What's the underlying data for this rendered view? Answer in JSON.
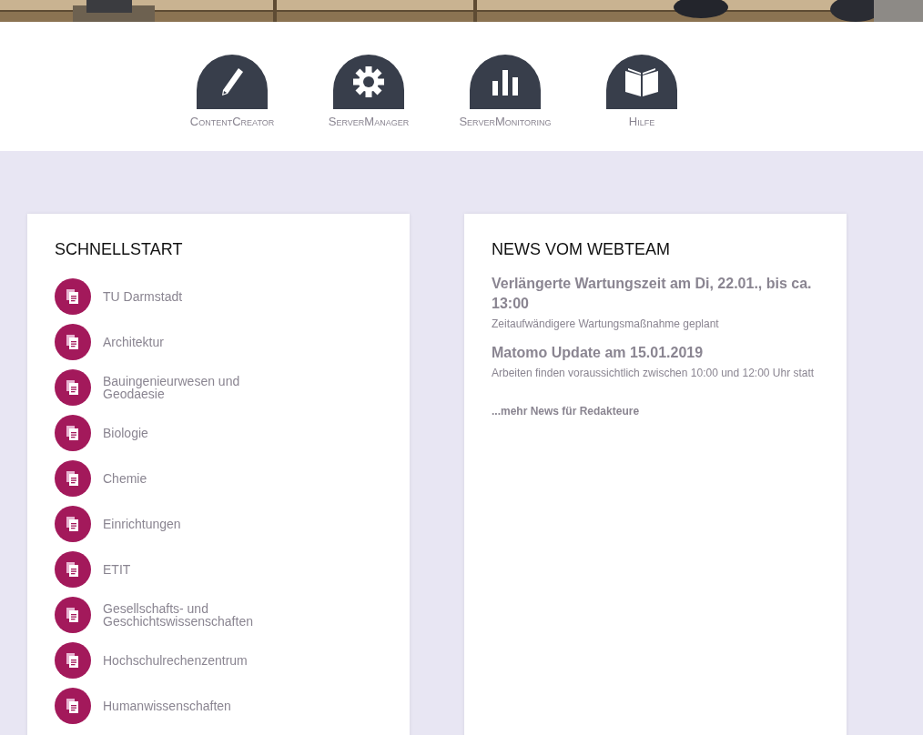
{
  "tools": [
    {
      "label": "ContentCreator"
    },
    {
      "label": "ServerManager"
    },
    {
      "label": "ServerMonitoring"
    },
    {
      "label": "Hilfe"
    }
  ],
  "quickstart": {
    "title": "SCHNELLSTART",
    "items": [
      "TU Darmstadt",
      "Architektur",
      "Bauingenieurwesen und Geodaesie",
      "Biologie",
      "Chemie",
      "Einrichtungen",
      "ETIT",
      "Gesellschafts- und Geschichtswissenschaften",
      "Hochschulrechenzentrum",
      "Humanwissenschaften"
    ]
  },
  "news": {
    "title": "NEWS VOM WEBTEAM",
    "items": [
      {
        "headline": "Verlängerte Wartungszeit am Di, 22.01., bis ca. 13:00",
        "text": "Zeitaufwändigere Wartungsmaßnahme geplant"
      },
      {
        "headline": "Matomo Update am 15.01.2019",
        "text": "Arbeiten finden voraussichtlich zwischen 10:00 und 12:00 Uhr statt"
      }
    ],
    "more_link": "...mehr News für Redakteure"
  }
}
